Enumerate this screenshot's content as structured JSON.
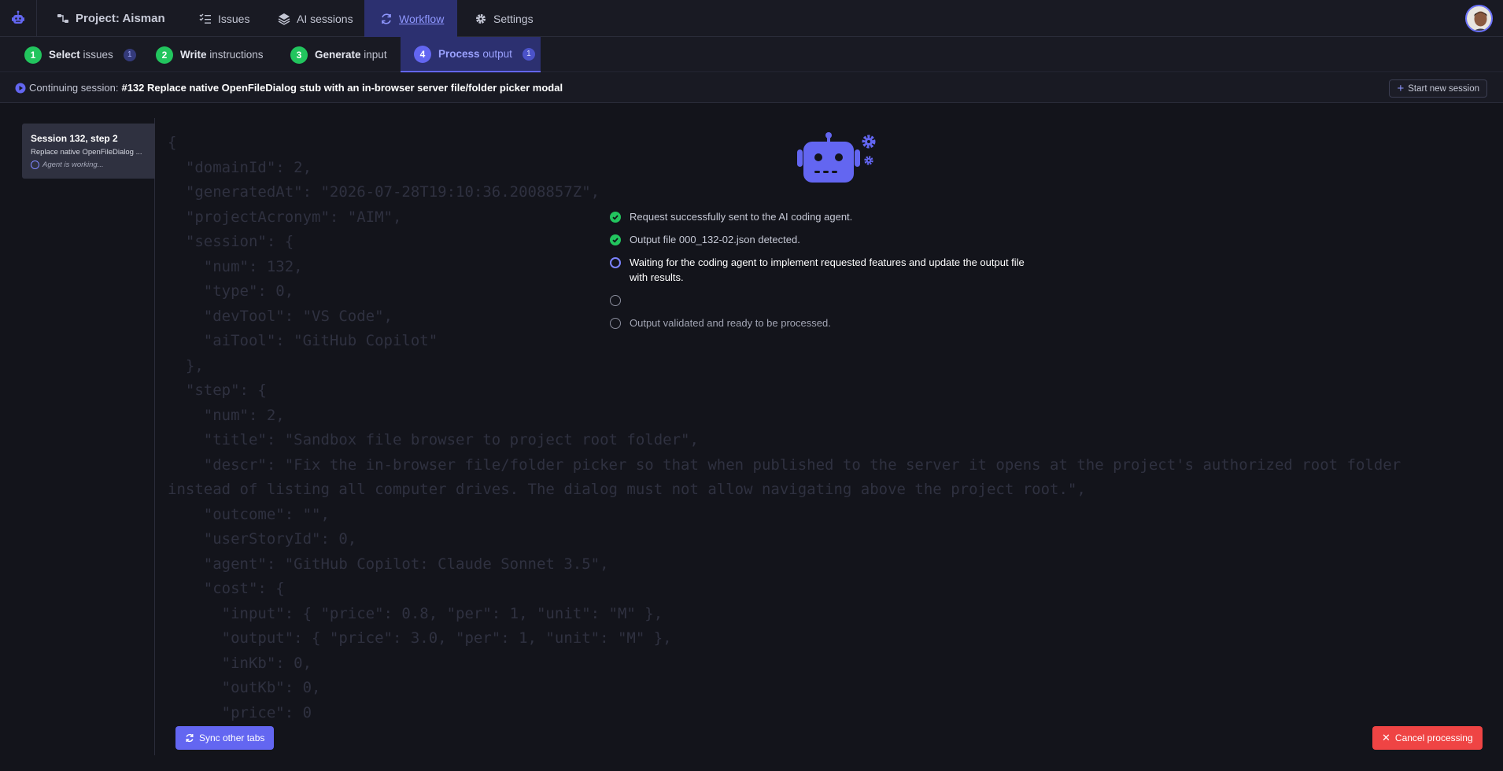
{
  "nav": {
    "project": "Project: Aisman",
    "issues": "Issues",
    "ai_sessions": "AI sessions",
    "workflow": "Workflow",
    "settings": "Settings",
    "icons": [
      "logo-robot-icon",
      "sitemap-icon",
      "tasks-icon",
      "layers-icon",
      "cycle-icon",
      "gear-icon"
    ]
  },
  "steps": [
    {
      "num": "1",
      "bold": "Select",
      "rest": "issues",
      "count": "1"
    },
    {
      "num": "2",
      "bold": "Write",
      "rest": "instructions"
    },
    {
      "num": "3",
      "bold": "Generate",
      "rest": "input"
    },
    {
      "num": "4",
      "bold": "Process",
      "rest": "output",
      "count": "1"
    }
  ],
  "session_bar": {
    "prefix": "Continuing session:",
    "title": "#132 Replace native OpenFileDialog stub with an in-browser server file/folder picker modal",
    "new_session": "Start new session"
  },
  "sidebar": {
    "card_title": "Session 132, step 2",
    "card_desc": "Replace native OpenFileDialog ...",
    "card_status": "Agent is working..."
  },
  "json_text": "{\n  \"domainId\": 2,\n  \"generatedAt\": \"2026-07-28T19:10:36.2008857Z\",\n  \"projectAcronym\": \"AIM\",\n  \"session\": {\n    \"num\": 132,\n    \"type\": 0,\n    \"devTool\": \"VS Code\",\n    \"aiTool\": \"GitHub Copilot\"\n  },\n  \"step\": {\n    \"num\": 2,\n    \"title\": \"Sandbox file browser to project root folder\",\n    \"descr\": \"Fix the in-browser file/folder picker so that when published to the server it opens at the project's authorized root folder\ninstead of listing all computer drives. The dialog must not allow navigating above the project root.\",\n    \"outcome\": \"\",\n    \"userStoryId\": 0,\n    \"agent\": \"GitHub Copilot: Claude Sonnet 3.5\",\n    \"cost\": {\n      \"input\": { \"price\": 0.8, \"per\": 1, \"unit\": \"M\" },\n      \"output\": { \"price\": 3.0, \"per\": 1, \"unit\": \"M\" },\n      \"inKb\": 0,\n      \"outKb\": 0,\n      \"price\": 0",
  "status": [
    {
      "state": "done",
      "text": "Request successfully sent to the AI coding agent."
    },
    {
      "state": "done",
      "text": "Output file 000_132-02.json detected."
    },
    {
      "state": "active",
      "text": "Waiting for the coding agent to implement requested features and update the output file with results."
    },
    {
      "state": "pending",
      "text": ""
    },
    {
      "state": "pending",
      "text": "Output validated and ready to be processed."
    }
  ],
  "buttons": {
    "sync": "Sync other tabs",
    "cancel": "Cancel processing"
  },
  "colors": {
    "accent": "#6366f1",
    "success": "#22c55e",
    "danger": "#ef4444",
    "background": "#13141b"
  }
}
